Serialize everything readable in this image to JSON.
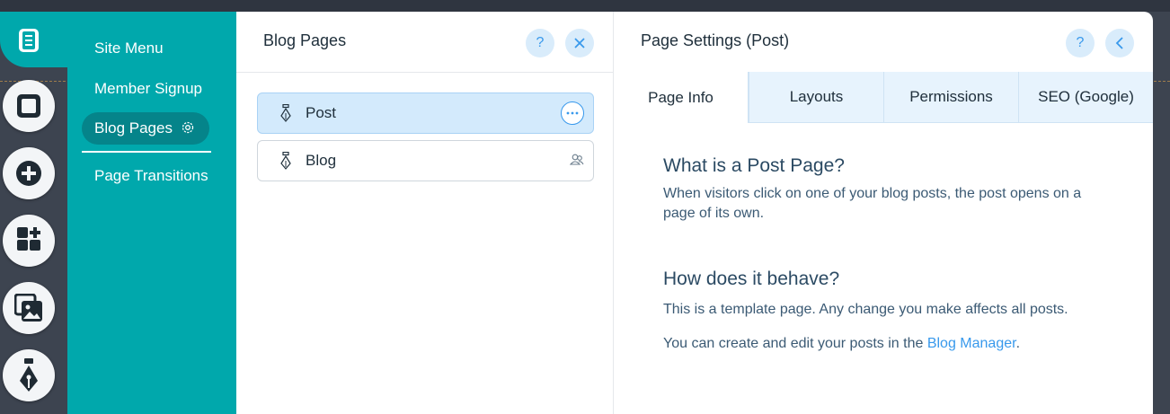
{
  "site_menu": {
    "items": [
      {
        "label": "Site Menu"
      },
      {
        "label": "Member Signup"
      },
      {
        "label": "Blog Pages"
      },
      {
        "label": "Page Transitions"
      }
    ]
  },
  "blog_pages": {
    "title": "Blog Pages",
    "pages": [
      {
        "label": "Post"
      },
      {
        "label": "Blog"
      }
    ]
  },
  "page_settings": {
    "title": "Page Settings (Post)",
    "tabs": [
      {
        "label": "Page Info"
      },
      {
        "label": "Layouts"
      },
      {
        "label": "Permissions"
      },
      {
        "label": "SEO (Google)"
      }
    ],
    "section1": {
      "heading": "What is a Post Page?",
      "body": "When visitors click on one of your blog posts, the post opens on a page of its own."
    },
    "section2": {
      "heading": "How does it behave?",
      "body": "This is a template page. Any change you make affects all posts.",
      "note_prefix": "You can create and edit your posts in the ",
      "note_link": "Blog Manager",
      "note_suffix": "."
    }
  },
  "colors": {
    "accent_teal": "#00a8ac",
    "active_teal": "#05848a",
    "link_blue": "#3899ec",
    "selected_row": "#d3eafc"
  },
  "icons": [
    "pages-icon",
    "box-icon",
    "add-icon",
    "apps-icon",
    "media-icon",
    "blog-pen-icon",
    "gear-icon",
    "help-icon",
    "close-icon",
    "back-icon",
    "more-icon",
    "members-icon"
  ]
}
